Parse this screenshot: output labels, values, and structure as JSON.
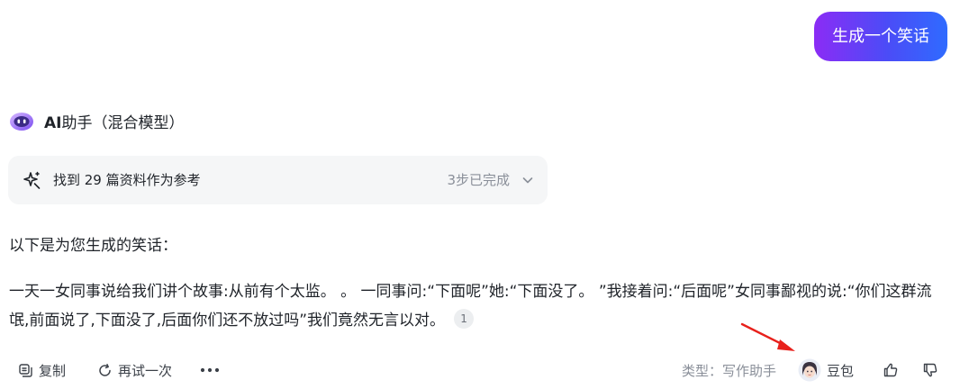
{
  "user_message": "生成一个笑话",
  "assistant": {
    "name_bold": "AI",
    "name_rest": "助手（混合模型）"
  },
  "reference_card": {
    "text": "找到 29 篇资料作为参考",
    "status": "3步已完成"
  },
  "response": {
    "intro": "以下是为您生成的笑话：",
    "joke": "一天一女同事说给我们讲个故事:从前有个太监。 。 一同事问:“下面呢”她:“下面没了。 ”我接着问:“后面呢”女同事鄙视的说:“你们这群流氓,前面说了,下面没了,后面你们还不放过吗”我们竟然无言以对。",
    "citation": "1"
  },
  "toolbar": {
    "copy": "复制",
    "retry": "再试一次",
    "type_label": "类型：写作助手",
    "model": "豆包"
  },
  "colors": {
    "accent_start": "#8b2cf5",
    "accent_end": "#2f6bff",
    "annotation_arrow": "#e8211c"
  }
}
